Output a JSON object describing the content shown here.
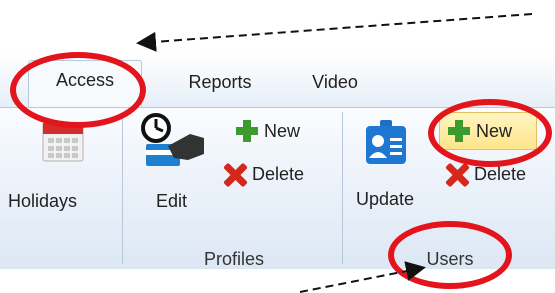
{
  "tabs": [
    {
      "label": "Access",
      "active": true
    },
    {
      "label": "Reports",
      "active": false
    },
    {
      "label": "Video",
      "active": false
    }
  ],
  "buttons": {
    "holidays": "Holidays",
    "edit": "Edit",
    "profiles_new": "New",
    "profiles_delete": "Delete",
    "update": "Update",
    "users_new": "New",
    "users_delete": "Delete"
  },
  "groups": {
    "profiles": "Profiles",
    "users": "Users"
  },
  "colors": {
    "annotation_ring": "#e3141b",
    "new_highlight": "#fde58a",
    "plus_icon": "#3c9a2e",
    "delete_icon": "#d4281c"
  },
  "icons": [
    "calendar-icon",
    "clock-hand-card-icon",
    "plus-icon",
    "delete-x-icon",
    "id-badge-icon"
  ]
}
